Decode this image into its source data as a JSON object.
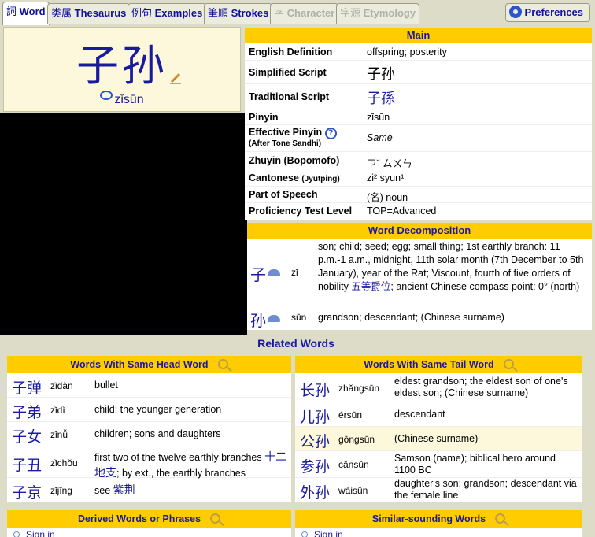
{
  "tabs": [
    {
      "cjk": "詞",
      "label": "Word",
      "state": "active"
    },
    {
      "cjk": "类属",
      "label": "Thesaurus",
      "state": "normal"
    },
    {
      "cjk": "例句",
      "label": "Examples",
      "state": "normal"
    },
    {
      "cjk": "筆順",
      "label": "Strokes",
      "state": "normal"
    },
    {
      "cjk": "字",
      "label": "Character",
      "state": "disabled"
    },
    {
      "cjk": "字源",
      "label": "Etymology",
      "state": "disabled"
    }
  ],
  "preferences_label": "Preferences",
  "word": {
    "hanzi": "子孙",
    "pinyin": "zǐsūn"
  },
  "main": {
    "header": "Main",
    "rows": [
      {
        "label": "English Definition",
        "value": "offspring; posterity"
      },
      {
        "label": "Simplified Script",
        "value": "子孙"
      },
      {
        "label": "Traditional Script",
        "value": "子孫"
      },
      {
        "label": "Pinyin",
        "value": "zǐsūn"
      },
      {
        "label": "Effective Pinyin",
        "sublabel": "(After Tone Sandhi)",
        "value": "Same"
      },
      {
        "label": "Zhuyin (Bopomofo)",
        "value": "ㄗˇ ㄙㄨㄣ"
      },
      {
        "label": "Cantonese",
        "sublabel": "(Jyutping)",
        "value": "zi² syun¹"
      },
      {
        "label": "Part of Speech",
        "value": "(名) noun"
      },
      {
        "label": "Proficiency Test Level",
        "value": "TOP=Advanced"
      }
    ]
  },
  "decomposition": {
    "header": "Word Decomposition",
    "items": [
      {
        "char": "子",
        "pinyin": "zǐ",
        "def_before": "son; child; seed; egg; small thing; 1st earthly branch: 11 p.m.-1 a.m., midnight, 11th solar month (7th December to 5th January), year of the Rat; Viscount, fourth of five orders of nobility ",
        "def_link": "五等爵位",
        "def_after": "; ancient Chinese compass point: 0° (north)"
      },
      {
        "char": "孙",
        "pinyin": "sūn",
        "def_before": "grandson; descendant; (Chinese surname)",
        "def_link": "",
        "def_after": ""
      }
    ]
  },
  "related": {
    "title": "Related Words",
    "head_panel": {
      "header": "Words With Same Head Word",
      "items": [
        {
          "word": "子弹",
          "pinyin": "zǐdàn",
          "def_before": "bullet",
          "def_link": "",
          "def_after": ""
        },
        {
          "word": "子弟",
          "pinyin": "zǐdì",
          "def_before": "child; the younger generation",
          "def_link": "",
          "def_after": ""
        },
        {
          "word": "子女",
          "pinyin": "zǐnǚ",
          "def_before": "children; sons and daughters",
          "def_link": "",
          "def_after": ""
        },
        {
          "word": "子丑",
          "pinyin": "zǐchǒu",
          "def_before": "first two of the twelve earthly branches ",
          "def_link": "十二地支",
          "def_after": "; by ext., the earthly branches"
        },
        {
          "word": "子京",
          "pinyin": "zǐjīng",
          "def_before": "see ",
          "def_link": "紫荆",
          "def_after": ""
        }
      ]
    },
    "tail_panel": {
      "header": "Words With Same Tail Word",
      "items": [
        {
          "word": "长孙",
          "pinyin": "zhǎngsūn",
          "def": "eldest grandson; the eldest son of one's eldest son; (Chinese surname)"
        },
        {
          "word": "儿孙",
          "pinyin": "érsūn",
          "def": "descendant"
        },
        {
          "word": "公孙",
          "pinyin": "gōngsūn",
          "def": "(Chinese surname)"
        },
        {
          "word": "参孙",
          "pinyin": "cānsūn",
          "def": "Samson (name); biblical hero around 1100 BC"
        },
        {
          "word": "外孙",
          "pinyin": "wàisūn",
          "def": "daughter's son; grandson; descendant via the female line"
        }
      ]
    },
    "derived_header": "Derived Words or Phrases",
    "similar_header": "Similar-sounding Words",
    "sign_in": "Sign in"
  }
}
